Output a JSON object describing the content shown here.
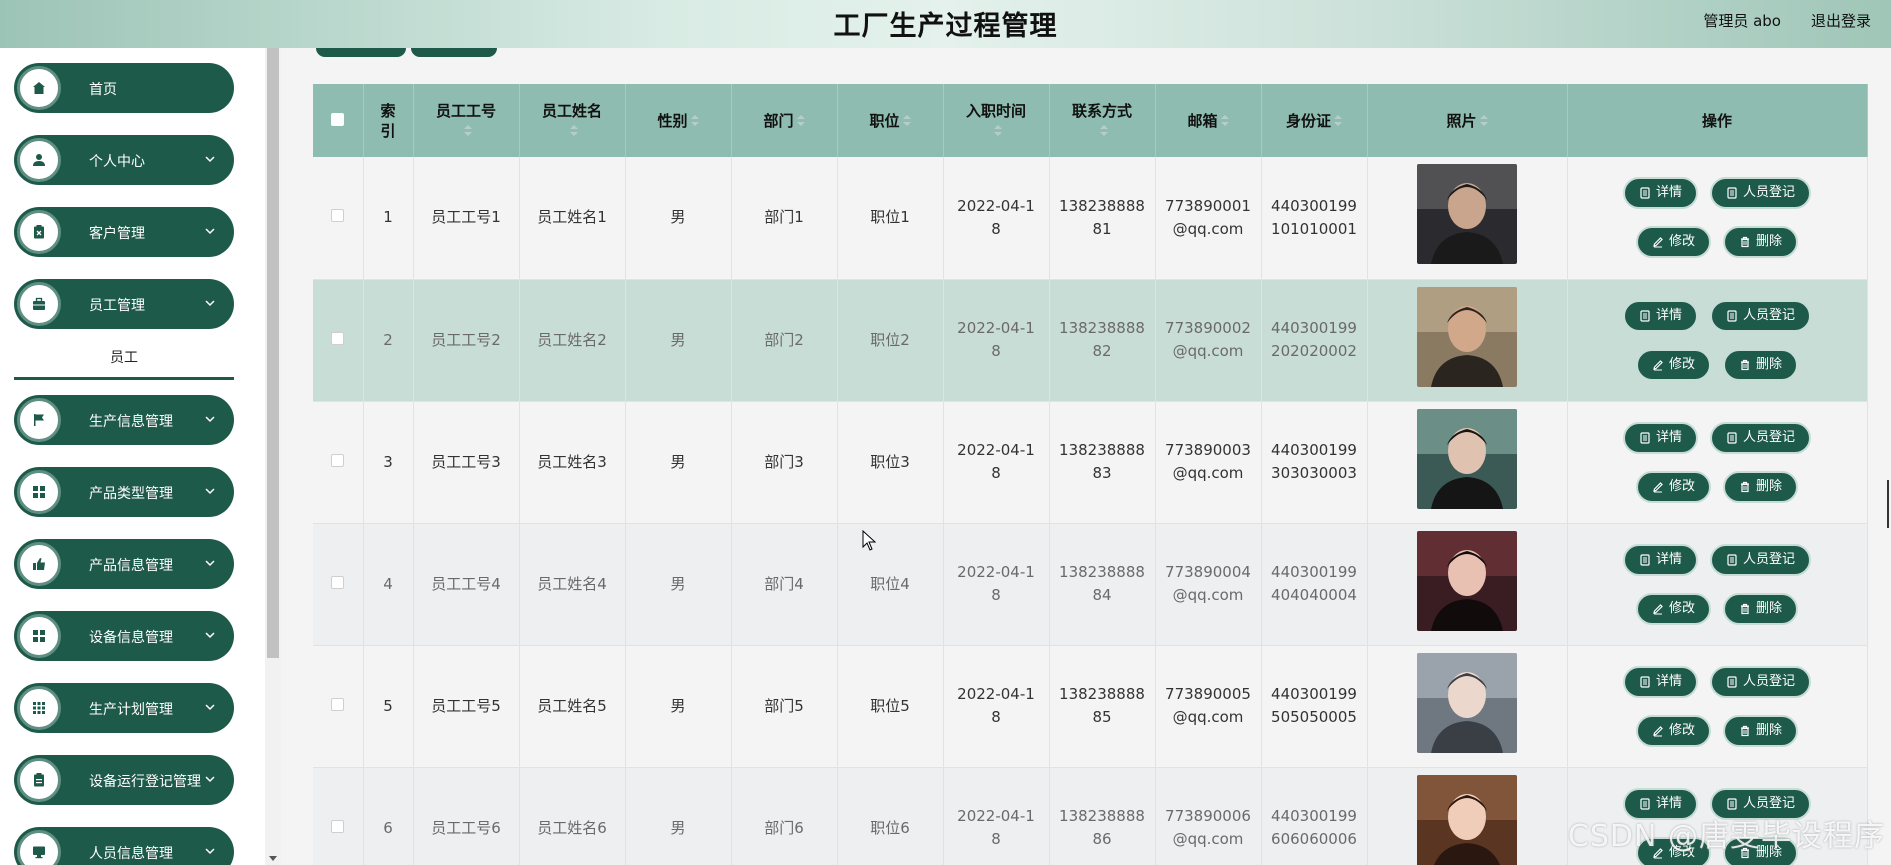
{
  "header": {
    "title": "工厂生产过程管理",
    "user": "管理员 abo",
    "logout": "退出登录"
  },
  "sidebar": {
    "items": [
      {
        "label": "首页",
        "icon": "home-icon",
        "chevron": false
      },
      {
        "label": "个人中心",
        "icon": "user-icon",
        "chevron": true
      },
      {
        "label": "客户管理",
        "icon": "clipboard-x-icon",
        "chevron": true
      },
      {
        "label": "员工管理",
        "icon": "briefcase-icon",
        "chevron": true
      },
      {
        "label": "生产信息管理",
        "icon": "flag-icon",
        "chevron": true
      },
      {
        "label": "产品类型管理",
        "icon": "grid-icon",
        "chevron": true
      },
      {
        "label": "产品信息管理",
        "icon": "thumbs-up-icon",
        "chevron": true
      },
      {
        "label": "设备信息管理",
        "icon": "grid-icon",
        "chevron": true
      },
      {
        "label": "生产计划管理",
        "icon": "apps-icon",
        "chevron": true
      },
      {
        "label": "设备运行登记管理",
        "icon": "clipboard-icon",
        "chevron": true
      },
      {
        "label": "人员信息管理",
        "icon": "monitor-icon",
        "chevron": true
      }
    ],
    "sub_item": "员工"
  },
  "table": {
    "columns": [
      "索引",
      "员工工号",
      "员工姓名",
      "性别",
      "部门",
      "职位",
      "入职时间",
      "联系方式",
      "邮箱",
      "身份证",
      "照片",
      "操作"
    ],
    "rows": [
      {
        "index": "1",
        "emp_no": "员工工号1",
        "name": "员工姓名1",
        "gender": "男",
        "dept": "部门1",
        "position": "职位1",
        "date": "2022-04-18",
        "phone": "13823888881",
        "email": "773890001@qq.com",
        "id_card": "440300199101010001"
      },
      {
        "index": "2",
        "emp_no": "员工工号2",
        "name": "员工姓名2",
        "gender": "男",
        "dept": "部门2",
        "position": "职位2",
        "date": "2022-04-18",
        "phone": "13823888882",
        "email": "773890002@qq.com",
        "id_card": "440300199202020002"
      },
      {
        "index": "3",
        "emp_no": "员工工号3",
        "name": "员工姓名3",
        "gender": "男",
        "dept": "部门3",
        "position": "职位3",
        "date": "2022-04-18",
        "phone": "13823888883",
        "email": "773890003@qq.com",
        "id_card": "440300199303030003"
      },
      {
        "index": "4",
        "emp_no": "员工工号4",
        "name": "员工姓名4",
        "gender": "男",
        "dept": "部门4",
        "position": "职位4",
        "date": "2022-04-18",
        "phone": "13823888884",
        "email": "773890004@qq.com",
        "id_card": "440300199404040004"
      },
      {
        "index": "5",
        "emp_no": "员工工号5",
        "name": "员工姓名5",
        "gender": "男",
        "dept": "部门5",
        "position": "职位5",
        "date": "2022-04-18",
        "phone": "13823888885",
        "email": "773890005@qq.com",
        "id_card": "440300199505050005"
      },
      {
        "index": "6",
        "emp_no": "员工工号6",
        "name": "员工姓名6",
        "gender": "男",
        "dept": "部门6",
        "position": "职位6",
        "date": "2022-04-18",
        "phone": "13823888886",
        "email": "773890006@qq.com",
        "id_card": "440300199606060006"
      }
    ],
    "actions": {
      "detail": "详情",
      "register": "人员登记",
      "edit": "修改",
      "delete": "删除"
    }
  },
  "watermark": "CSDN @唐雯毕设程序",
  "colors": {
    "primary": "#1e5a4a",
    "header_row": "#8fbcb0",
    "hover_row": "#c9ddd7"
  }
}
